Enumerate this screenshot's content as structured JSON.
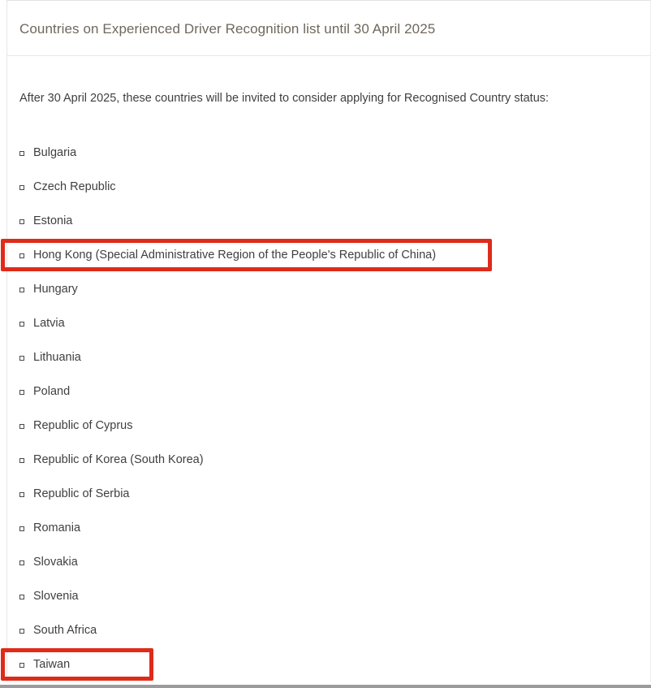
{
  "card": {
    "title": "Countries on Experienced Driver Recognition list until 30 April 2025",
    "intro": "After 30 April 2025, these countries will be invited to consider applying for Recognised Country status:",
    "bullet_icon": "open-square-bullet-icon",
    "countries": [
      {
        "name": "Bulgaria",
        "annotated": false
      },
      {
        "name": "Czech Republic",
        "annotated": false
      },
      {
        "name": "Estonia",
        "annotated": false
      },
      {
        "name": "Hong Kong (Special Administrative Region of the People's Republic of China)",
        "annotated": true
      },
      {
        "name": "Hungary",
        "annotated": false
      },
      {
        "name": "Latvia",
        "annotated": false
      },
      {
        "name": "Lithuania",
        "annotated": false
      },
      {
        "name": "Poland",
        "annotated": false
      },
      {
        "name": "Republic of Cyprus",
        "annotated": false
      },
      {
        "name": "Republic of Korea (South Korea)",
        "annotated": false
      },
      {
        "name": "Republic of Serbia",
        "annotated": false
      },
      {
        "name": "Romania",
        "annotated": false
      },
      {
        "name": "Slovakia",
        "annotated": false
      },
      {
        "name": "Slovenia",
        "annotated": false
      },
      {
        "name": "South Africa",
        "annotated": false
      },
      {
        "name": "Taiwan",
        "annotated": true
      }
    ]
  },
  "colors": {
    "title_text": "#6f675c",
    "body_text": "#3f3f3f",
    "annotation_red": "#de2b1a",
    "divider": "#e8e8e8",
    "bottom_bar": "#9b9b9e",
    "background": "#ffffff"
  }
}
